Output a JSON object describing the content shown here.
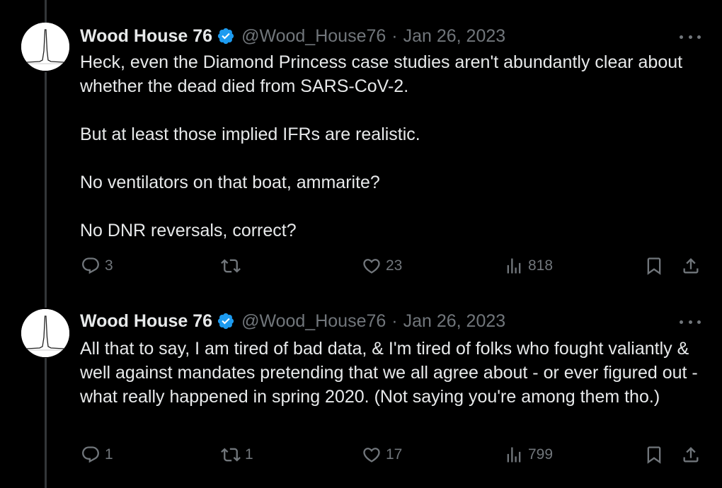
{
  "tweets": [
    {
      "author_name": "Wood House 76",
      "handle": "@Wood_House76",
      "separator": "·",
      "date": "Jan 26, 2023",
      "paragraphs": [
        "Heck, even the Diamond Princess case studies aren't abundantly clear about whether the dead died from SARS-CoV-2.",
        "But at least those implied IFRs are realistic.",
        "No ventilators on that boat, ammarite?",
        "No DNR reversals, correct?"
      ],
      "replies": "3",
      "retweets": "",
      "likes": "23",
      "views": "818"
    },
    {
      "author_name": "Wood House 76",
      "handle": "@Wood_House76",
      "separator": "·",
      "date": "Jan 26, 2023",
      "paragraphs": [
        "All that to say, I am tired of bad data, & I'm tired of folks who fought valiantly & well against mandates pretending that we all agree about - or ever figured out - what really happened in spring 2020. (Not saying you're among them tho.)"
      ],
      "replies": "1",
      "retweets": "1",
      "likes": "17",
      "views": "799"
    }
  ],
  "colors": {
    "background": "#000000",
    "text": "#e7e9ea",
    "muted": "#71767b",
    "verified": "#1d9bf0",
    "thread_line": "#333639"
  },
  "icons": {
    "avatar": "spectrum-peak-avatar",
    "verified": "verified-badge-icon",
    "reply": "reply-icon",
    "retweet": "retweet-icon",
    "like": "heart-icon",
    "views": "views-icon",
    "bookmark": "bookmark-icon",
    "share": "share-icon",
    "more": "more-icon"
  }
}
